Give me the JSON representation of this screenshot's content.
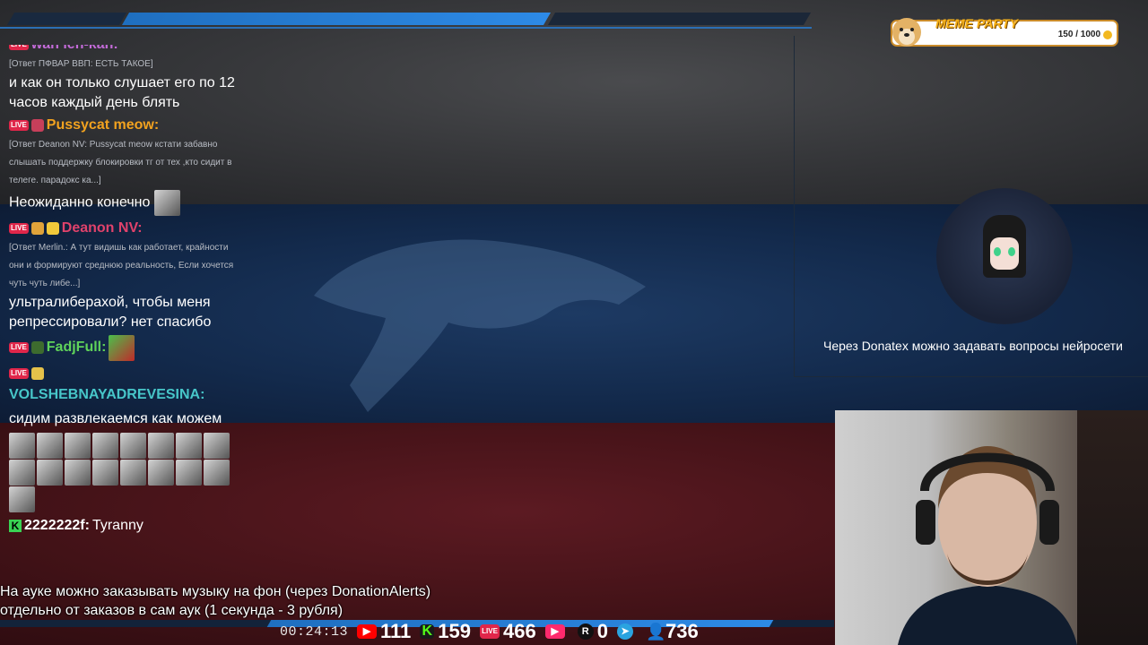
{
  "chat": {
    "top_partial_user": "wan ien-kan:",
    "messages": [
      {
        "reply": "[Ответ ПФВАР ВВП: ЕСТЬ ТАКОЕ]",
        "text": "и как он только слушает его по 12 часов каждый день блять"
      },
      {
        "user": "Pussycat meow:",
        "user_color": "#f2a21f",
        "reply": "[Ответ Deanon NV: Pussycat meow кстати забавно слышать поддержку блокировки тг от тех ,кто сидит в телеге. парадокс ка...]",
        "text": "Неожиданно конечно"
      },
      {
        "user": "Deanon NV:",
        "user_color": "#e0426b",
        "reply": "[Ответ Merlin.: А тут видишь как работает, крайности они и формируют среднюю реальность, Если хочется чуть чуть либе...]",
        "text": "ультралиберахой, чтобы меня репрессировали? нет спасибо"
      },
      {
        "user": "FadjFull:",
        "user_color": "#5fd35a",
        "reply": "",
        "text": ""
      },
      {
        "user": "VOLSHEBNAYADREVESINA:",
        "user_color": "#47c6c9",
        "reply": "",
        "text": "сидим развлекаемся как можем"
      },
      {
        "user": "2222222f:",
        "user_color": "#ffffff",
        "reply": "",
        "text": "Tyranny"
      }
    ],
    "live_badge": "LIVE"
  },
  "announcement": {
    "line1": "На ауке можно заказывать музыку на фон (через DonationAlerts)",
    "line2": "отдельно от заказов в сам аук (1 секунда - 3 рубля)"
  },
  "stats": {
    "timer": "00:24:13",
    "youtube": "111",
    "kick": "159",
    "vklive": "466",
    "play": "",
    "rutube": "0",
    "telegram": "",
    "viewers": "736",
    "live_label": "LIVE",
    "kick_label": "K",
    "rutube_label": "R"
  },
  "meme_party": {
    "title": "MEME PARTY",
    "progress": "150 / 1000",
    "progress_value": 0.15
  },
  "donatex_text": "Через Donatex можно задавать вопросы нейросети",
  "colors": {
    "grey_band": "#37383b",
    "blue_band": "#132a4c",
    "red_band": "#421217",
    "accent_blue": "#2d8ae6"
  }
}
